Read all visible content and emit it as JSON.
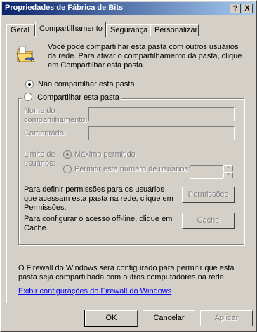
{
  "window": {
    "title": "Propriedades de Fábrica de Bits",
    "help_btn": "?",
    "close_btn": "X"
  },
  "tabs": [
    {
      "label": "Geral"
    },
    {
      "label": "Compartilhamento"
    },
    {
      "label": "Segurança"
    },
    {
      "label": "Personalizar"
    }
  ],
  "sharing": {
    "intro": "Você pode compartilhar esta pasta com outros usuários da rede. Para ativar o compartilhamento da pasta, clique em Compartilhar esta pasta.",
    "no_share_label": "Não compartilhar esta pasta",
    "share_label": "Compartilhar esta pasta",
    "share_name_label": "Nome do compartilhamento:",
    "comment_label": "Comentário:",
    "user_limit_label": "Limite de usuários:",
    "max_allowed_label": "Máximo permitido",
    "allow_users_label": "Permitir este número de usuários:",
    "permissions_text": "Para definir permissões para os usuários que acessam esta pasta na rede, clique em Permissões.",
    "permissions_button": "Permissões",
    "cache_text": "Para configurar o acesso off-line, clique em Cache.",
    "cache_button": "Cache",
    "firewall_text": "O Firewall do Windows será configurado para permitir que esta pasta seja compartilhada com outros computadores na rede.",
    "firewall_link": "Exibir configurações do Firewall do Windows"
  },
  "footer": {
    "ok": "OK",
    "cancel": "Cancelar",
    "apply": "Aplicar"
  },
  "icons": {
    "folder": "shared-folder-icon"
  },
  "colors": {
    "titlebar_start": "#0a246a",
    "titlebar_end": "#a6caf0",
    "link": "#0000ff"
  }
}
